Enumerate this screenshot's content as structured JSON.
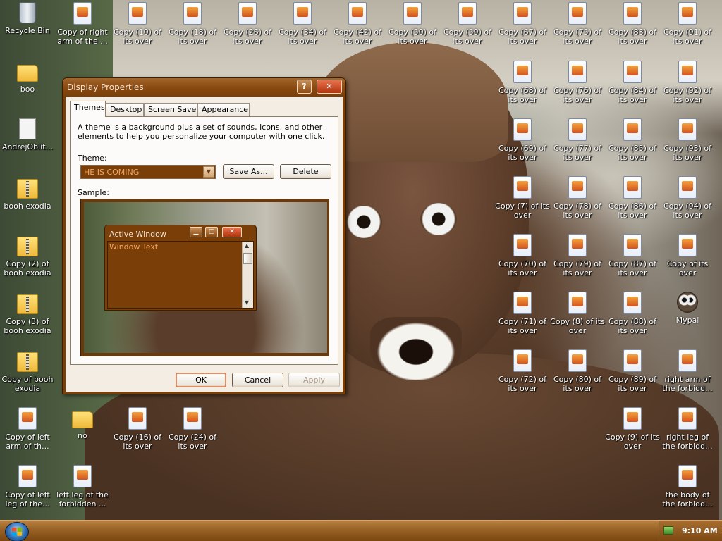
{
  "desktop": {
    "icons": [
      {
        "label": "Recycle Bin",
        "kind": "bin"
      },
      {
        "label": "Copy of right arm of the ...",
        "kind": "file"
      },
      {
        "label": "Copy (10) of its over",
        "kind": "file"
      },
      {
        "label": "Copy (18) of its over",
        "kind": "file"
      },
      {
        "label": "Copy (26) of its over",
        "kind": "file"
      },
      {
        "label": "Copy (34) of its over",
        "kind": "file"
      },
      {
        "label": "Copy (42) of its over",
        "kind": "file"
      },
      {
        "label": "Copy (50) of its over",
        "kind": "file"
      },
      {
        "label": "Copy (59) of its over",
        "kind": "file"
      },
      {
        "label": "Copy (67) of its over",
        "kind": "file"
      },
      {
        "label": "Copy (75) of its over",
        "kind": "file"
      },
      {
        "label": "Copy (83) of its over",
        "kind": "file"
      },
      {
        "label": "Copy (91) of its over",
        "kind": "file"
      },
      {
        "label": "boo",
        "kind": "folder"
      },
      {
        "label": "Copy (68) of its over",
        "kind": "file"
      },
      {
        "label": "Copy (76) of its over",
        "kind": "file"
      },
      {
        "label": "Copy (84) of its over",
        "kind": "file"
      },
      {
        "label": "Copy (92) of its over",
        "kind": "file"
      },
      {
        "label": "AndrejOblit...",
        "kind": "doc"
      },
      {
        "label": "Copy (69) of its over",
        "kind": "file"
      },
      {
        "label": "Copy (77) of its over",
        "kind": "file"
      },
      {
        "label": "Copy (85) of its over",
        "kind": "file"
      },
      {
        "label": "Copy (93) of its over",
        "kind": "file"
      },
      {
        "label": "booh exodia",
        "kind": "zip"
      },
      {
        "label": "Copy (7) of its over",
        "kind": "file"
      },
      {
        "label": "Copy (78) of its over",
        "kind": "file"
      },
      {
        "label": "Copy (86) of its over",
        "kind": "file"
      },
      {
        "label": "Copy (94) of its over",
        "kind": "file"
      },
      {
        "label": "Copy (2) of booh exodia",
        "kind": "zip"
      },
      {
        "label": "Copy (70) of its over",
        "kind": "file"
      },
      {
        "label": "Copy (79) of its over",
        "kind": "file"
      },
      {
        "label": "Copy (87) of its over",
        "kind": "file"
      },
      {
        "label": "Copy of its over",
        "kind": "file"
      },
      {
        "label": "Copy (3) of booh exodia",
        "kind": "zip"
      },
      {
        "label": "Copy (71) of its over",
        "kind": "file"
      },
      {
        "label": "Copy (8) of its over",
        "kind": "file"
      },
      {
        "label": "Copy (88) of its over",
        "kind": "file"
      },
      {
        "label": "Mypal",
        "kind": "raccoon"
      },
      {
        "label": "Copy of booh exodia",
        "kind": "zip"
      },
      {
        "label": "Copy (72) of its over",
        "kind": "file"
      },
      {
        "label": "Copy (80) of its over",
        "kind": "file"
      },
      {
        "label": "Copy (89) of its over",
        "kind": "file"
      },
      {
        "label": "right arm of the forbidd...",
        "kind": "file"
      },
      {
        "label": "Copy of left arm of th...",
        "kind": "file"
      },
      {
        "label": "no",
        "kind": "folder"
      },
      {
        "label": "Copy (16) of its over",
        "kind": "file"
      },
      {
        "label": "Copy (24) of its over",
        "kind": "file"
      },
      {
        "label": "Copy (9) of its over",
        "kind": "file"
      },
      {
        "label": "right leg of the forbidd...",
        "kind": "file"
      },
      {
        "label": "Copy of left leg of the...",
        "kind": "file"
      },
      {
        "label": "left leg of the forbidden ...",
        "kind": "file"
      },
      {
        "label": "the body of the forbidd...",
        "kind": "file"
      }
    ]
  },
  "dialog": {
    "title": "Display Properties",
    "help_label": "?",
    "close_label": "✕",
    "tabs": [
      {
        "label": "Themes"
      },
      {
        "label": "Desktop"
      },
      {
        "label": "Screen Saver"
      },
      {
        "label": "Appearance"
      }
    ],
    "description": "A theme is a background plus a set of sounds, icons, and other elements to help you personalize your computer with one click.",
    "theme_label": "Theme:",
    "theme_value": "HE IS COMING",
    "save_as_label": "Save As...",
    "delete_label": "Delete",
    "sample_label": "Sample:",
    "sample": {
      "window_title": "Active Window",
      "window_text": "Window Text"
    },
    "ok_label": "OK",
    "cancel_label": "Cancel",
    "apply_label": "Apply"
  },
  "taskbar": {
    "clock": "9:10 AM"
  },
  "colors": {
    "window_frame": "#7a3f08",
    "window_text": "#f5a460",
    "taskbar": "#9b6428"
  }
}
